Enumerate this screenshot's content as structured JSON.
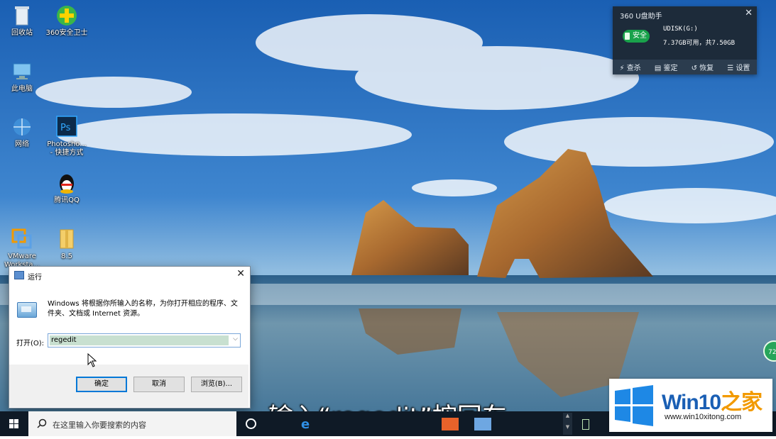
{
  "desktop": {
    "icons": [
      {
        "label": "回收站"
      },
      {
        "label": "360安全卫士"
      },
      {
        "label": "此电脑"
      },
      {
        "label": "网络"
      },
      {
        "label": "Photosho...",
        "label2": "- 快捷方式"
      },
      {
        "label": "腾讯QQ"
      },
      {
        "label": "VMware",
        "label2": "Worksta..."
      },
      {
        "label": "8.5"
      }
    ]
  },
  "udisk_widget": {
    "title": "360 U盘助手",
    "status": "安全",
    "drive_name": "UDISK(G:)",
    "capacity": "7.37GB可用，共7.50GB",
    "actions": [
      "查杀",
      "鉴定",
      "恢复",
      "设置"
    ],
    "close": "✕"
  },
  "run_dialog": {
    "title": "运行",
    "close": "✕",
    "description": "Windows 将根据你所输入的名称，为你打开相应的程序、文件夹、文档或 Internet 资源。",
    "open_label": "打开(O):",
    "open_value": "regedit",
    "ok_label": "确定",
    "cancel_label": "取消",
    "browse_label": "浏览(B)..."
  },
  "subtitle": "输入“regedit”按回车",
  "taskbar": {
    "search_placeholder": "在这里输入你要搜索的内容"
  },
  "tray_badge": "72",
  "watermark": {
    "brand_en": "Win10",
    "brand_zh": "之家",
    "url": "www.win10xitong.com"
  },
  "colors": {
    "accent": "#0078d7",
    "taskbar": "#0f1a26",
    "udisk_safe": "#19a24b",
    "watermark_blue": "#1a5fb4",
    "watermark_orange": "#f29a00"
  }
}
